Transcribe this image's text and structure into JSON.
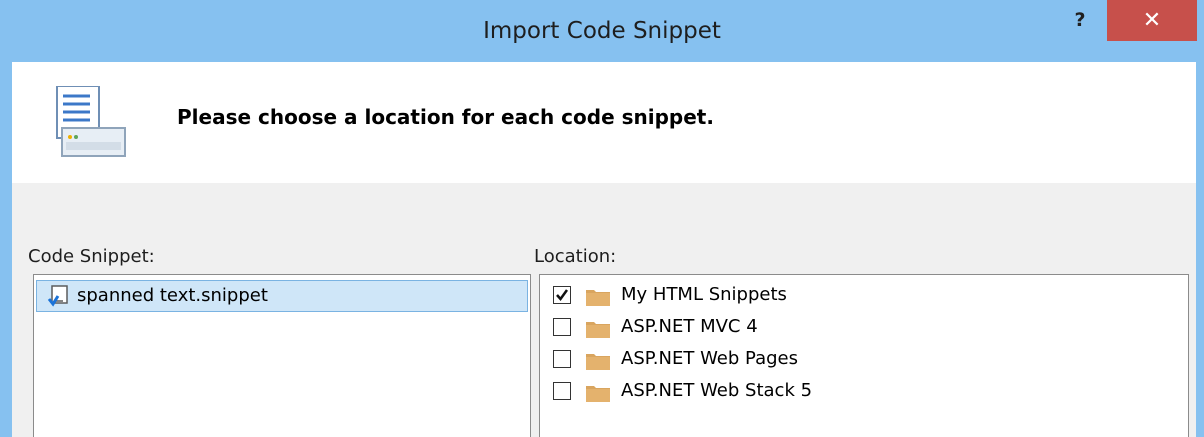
{
  "window": {
    "title": "Import Code Snippet",
    "help_label": "?",
    "close_label": "✕"
  },
  "banner": {
    "text": "Please choose a location for each code snippet."
  },
  "snippets": {
    "label": "Code Snippet:",
    "items": [
      {
        "name": "spanned text.snippet",
        "selected": true
      }
    ]
  },
  "locations": {
    "label": "Location:",
    "items": [
      {
        "label": "My HTML Snippets",
        "checked": true
      },
      {
        "label": "ASP.NET MVC 4",
        "checked": false
      },
      {
        "label": "ASP.NET Web Pages",
        "checked": false
      },
      {
        "label": "ASP.NET Web Stack 5",
        "checked": false
      }
    ]
  },
  "colors": {
    "titlebar": "#86c1f0",
    "close": "#c7504b",
    "selection": "#cfe6f8",
    "folder": "#d9a55f"
  }
}
